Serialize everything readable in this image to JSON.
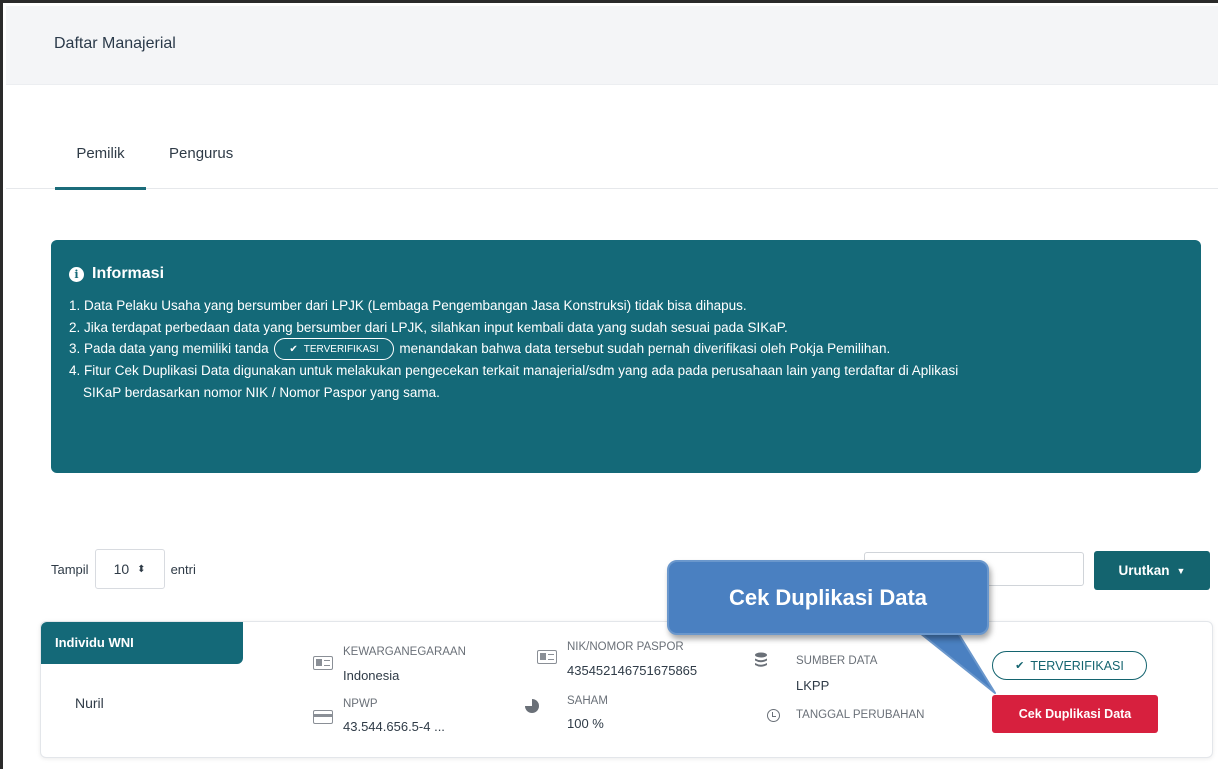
{
  "header": {
    "title": "Daftar Manajerial"
  },
  "tabs": [
    {
      "label": "Pemilik",
      "active": true
    },
    {
      "label": "Pengurus",
      "active": false
    }
  ],
  "info": {
    "title": "Informasi",
    "icon": "info-icon",
    "items": [
      "1. Data Pelaku Usaha yang bersumber dari LPJK (Lembaga Pengembangan Jasa Konstruksi) tidak bisa dihapus.",
      "2. Jika terdapat perbedaan data yang bersumber dari LPJK, silahkan input kembali data yang sudah sesuai pada SIKaP.",
      "3. Pada data yang memiliki tanda",
      "menandakan bahwa data tersebut sudah pernah diverifikasi oleh Pokja Pemilihan.",
      "4. Fitur Cek Duplikasi Data digunakan untuk melakukan pengecekan terkait manajerial/sdm yang ada pada perusahaan lain yang terdaftar di Aplikasi",
      "SIKaP berdasarkan nomor NIK / Nomor Paspor yang sama."
    ],
    "badge_label": "TERVERIFIKASI"
  },
  "controls": {
    "show_label": "Tampil",
    "entries_value": "10",
    "entries_label": "entri",
    "search_placeholder": "",
    "sort_label": "Urutkan"
  },
  "record": {
    "tag": "Individu WNI",
    "name": "Nuril",
    "kewarganegaraan_label": "KEWARGANEGARAAN",
    "kewarganegaraan_value": "Indonesia",
    "npwp_label": "NPWP",
    "npwp_value": "43.544.656.5-4 ...",
    "nik_label": "NIK/NOMOR PASPOR",
    "nik_value": "435452146751675865",
    "saham_label": "SAHAM",
    "saham_value": "100 %",
    "sumber_label": "SUMBER DATA",
    "sumber_value": "LKPP",
    "tanggal_label": "TANGGAL PERUBAHAN",
    "verified_label": "TERVERIFIKASI",
    "cek_button": "Cek Duplikasi Data"
  },
  "callout": {
    "text": "Cek Duplikasi Data"
  },
  "colors": {
    "primary": "#146978",
    "danger": "#d7203e",
    "callout": "#4a80c1"
  }
}
